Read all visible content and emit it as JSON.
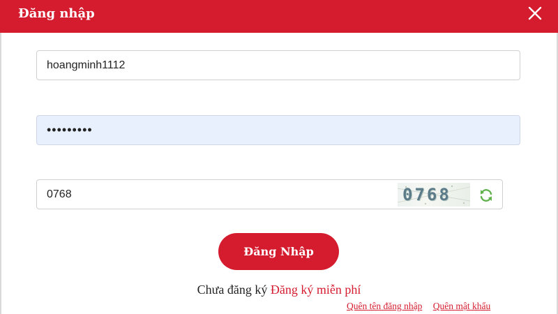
{
  "dialog": {
    "title": "Đăng nhập",
    "close_icon": "close-icon"
  },
  "form": {
    "username_value": "hoangminh1112",
    "password_value": "•••••••••",
    "captcha_value": "0768",
    "captcha_image_text": "0768",
    "refresh_icon": "refresh-icon",
    "login_label": "Đăng Nhập"
  },
  "footer": {
    "register_prompt": "Chưa đăng ký",
    "register_link": "Đăng ký miễn phí",
    "forgot_username": "Quên tên đăng nhập",
    "forgot_password": "Quên mật khẩu"
  },
  "colors": {
    "brand_red": "#d51c2f",
    "password_autofill_bg": "#e8f0fe",
    "refresh_green": "#5fb14a"
  }
}
